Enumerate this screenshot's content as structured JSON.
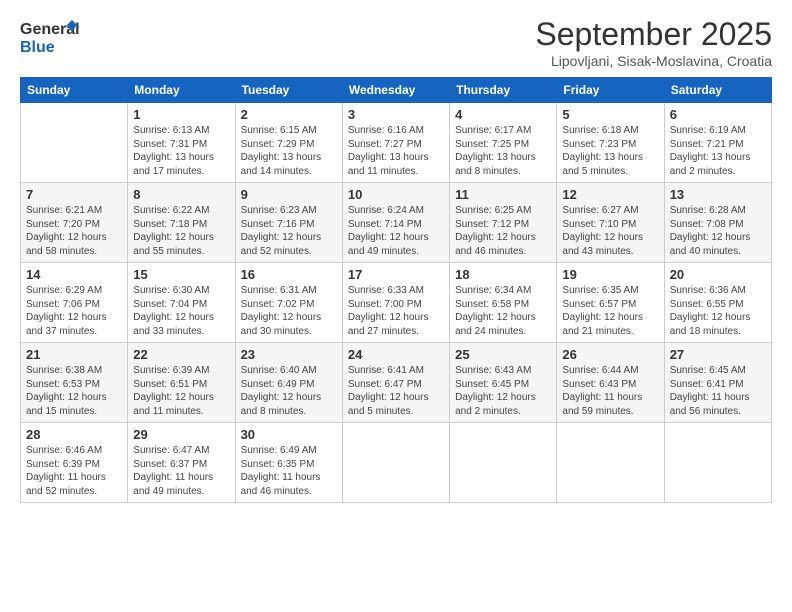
{
  "header": {
    "logo_line1": "General",
    "logo_line2": "Blue",
    "month": "September 2025",
    "location": "Lipovljani, Sisak-Moslavina, Croatia"
  },
  "days_of_week": [
    "Sunday",
    "Monday",
    "Tuesday",
    "Wednesday",
    "Thursday",
    "Friday",
    "Saturday"
  ],
  "weeks": [
    [
      {
        "day": "",
        "info": ""
      },
      {
        "day": "1",
        "info": "Sunrise: 6:13 AM\nSunset: 7:31 PM\nDaylight: 13 hours\nand 17 minutes."
      },
      {
        "day": "2",
        "info": "Sunrise: 6:15 AM\nSunset: 7:29 PM\nDaylight: 13 hours\nand 14 minutes."
      },
      {
        "day": "3",
        "info": "Sunrise: 6:16 AM\nSunset: 7:27 PM\nDaylight: 13 hours\nand 11 minutes."
      },
      {
        "day": "4",
        "info": "Sunrise: 6:17 AM\nSunset: 7:25 PM\nDaylight: 13 hours\nand 8 minutes."
      },
      {
        "day": "5",
        "info": "Sunrise: 6:18 AM\nSunset: 7:23 PM\nDaylight: 13 hours\nand 5 minutes."
      },
      {
        "day": "6",
        "info": "Sunrise: 6:19 AM\nSunset: 7:21 PM\nDaylight: 13 hours\nand 2 minutes."
      }
    ],
    [
      {
        "day": "7",
        "info": "Sunrise: 6:21 AM\nSunset: 7:20 PM\nDaylight: 12 hours\nand 58 minutes."
      },
      {
        "day": "8",
        "info": "Sunrise: 6:22 AM\nSunset: 7:18 PM\nDaylight: 12 hours\nand 55 minutes."
      },
      {
        "day": "9",
        "info": "Sunrise: 6:23 AM\nSunset: 7:16 PM\nDaylight: 12 hours\nand 52 minutes."
      },
      {
        "day": "10",
        "info": "Sunrise: 6:24 AM\nSunset: 7:14 PM\nDaylight: 12 hours\nand 49 minutes."
      },
      {
        "day": "11",
        "info": "Sunrise: 6:25 AM\nSunset: 7:12 PM\nDaylight: 12 hours\nand 46 minutes."
      },
      {
        "day": "12",
        "info": "Sunrise: 6:27 AM\nSunset: 7:10 PM\nDaylight: 12 hours\nand 43 minutes."
      },
      {
        "day": "13",
        "info": "Sunrise: 6:28 AM\nSunset: 7:08 PM\nDaylight: 12 hours\nand 40 minutes."
      }
    ],
    [
      {
        "day": "14",
        "info": "Sunrise: 6:29 AM\nSunset: 7:06 PM\nDaylight: 12 hours\nand 37 minutes."
      },
      {
        "day": "15",
        "info": "Sunrise: 6:30 AM\nSunset: 7:04 PM\nDaylight: 12 hours\nand 33 minutes."
      },
      {
        "day": "16",
        "info": "Sunrise: 6:31 AM\nSunset: 7:02 PM\nDaylight: 12 hours\nand 30 minutes."
      },
      {
        "day": "17",
        "info": "Sunrise: 6:33 AM\nSunset: 7:00 PM\nDaylight: 12 hours\nand 27 minutes."
      },
      {
        "day": "18",
        "info": "Sunrise: 6:34 AM\nSunset: 6:58 PM\nDaylight: 12 hours\nand 24 minutes."
      },
      {
        "day": "19",
        "info": "Sunrise: 6:35 AM\nSunset: 6:57 PM\nDaylight: 12 hours\nand 21 minutes."
      },
      {
        "day": "20",
        "info": "Sunrise: 6:36 AM\nSunset: 6:55 PM\nDaylight: 12 hours\nand 18 minutes."
      }
    ],
    [
      {
        "day": "21",
        "info": "Sunrise: 6:38 AM\nSunset: 6:53 PM\nDaylight: 12 hours\nand 15 minutes."
      },
      {
        "day": "22",
        "info": "Sunrise: 6:39 AM\nSunset: 6:51 PM\nDaylight: 12 hours\nand 11 minutes."
      },
      {
        "day": "23",
        "info": "Sunrise: 6:40 AM\nSunset: 6:49 PM\nDaylight: 12 hours\nand 8 minutes."
      },
      {
        "day": "24",
        "info": "Sunrise: 6:41 AM\nSunset: 6:47 PM\nDaylight: 12 hours\nand 5 minutes."
      },
      {
        "day": "25",
        "info": "Sunrise: 6:43 AM\nSunset: 6:45 PM\nDaylight: 12 hours\nand 2 minutes."
      },
      {
        "day": "26",
        "info": "Sunrise: 6:44 AM\nSunset: 6:43 PM\nDaylight: 11 hours\nand 59 minutes."
      },
      {
        "day": "27",
        "info": "Sunrise: 6:45 AM\nSunset: 6:41 PM\nDaylight: 11 hours\nand 56 minutes."
      }
    ],
    [
      {
        "day": "28",
        "info": "Sunrise: 6:46 AM\nSunset: 6:39 PM\nDaylight: 11 hours\nand 52 minutes."
      },
      {
        "day": "29",
        "info": "Sunrise: 6:47 AM\nSunset: 6:37 PM\nDaylight: 11 hours\nand 49 minutes."
      },
      {
        "day": "30",
        "info": "Sunrise: 6:49 AM\nSunset: 6:35 PM\nDaylight: 11 hours\nand 46 minutes."
      },
      {
        "day": "",
        "info": ""
      },
      {
        "day": "",
        "info": ""
      },
      {
        "day": "",
        "info": ""
      },
      {
        "day": "",
        "info": ""
      }
    ]
  ]
}
